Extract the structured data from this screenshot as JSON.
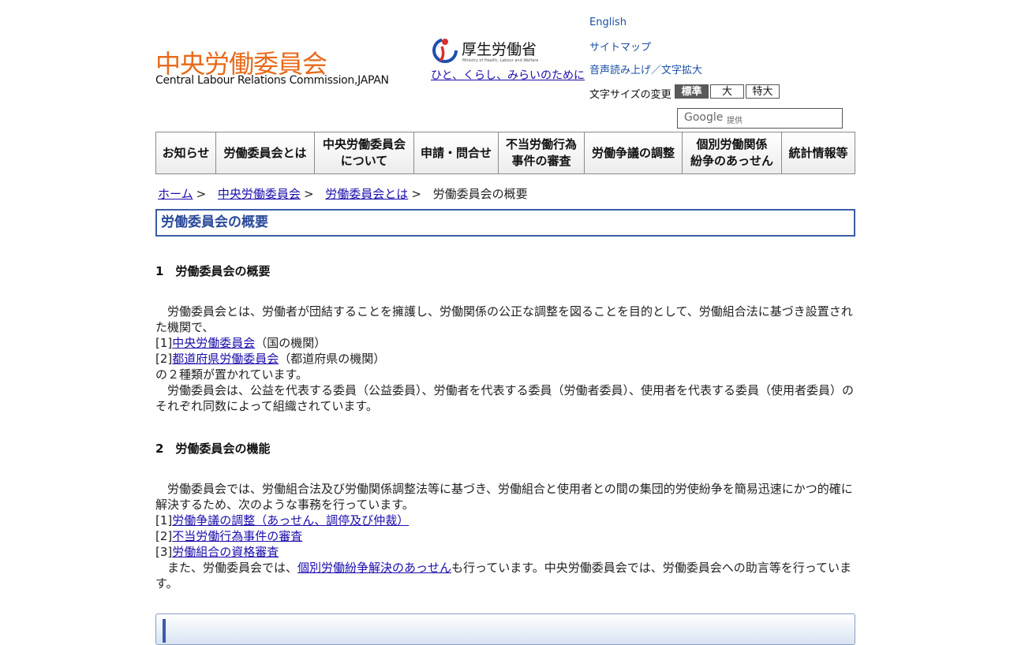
{
  "header": {
    "site_title": "中央労働委員会",
    "site_subtitle": "Central Labour Relations Commission,JAPAN",
    "mhlw_name": "厚生労働省",
    "mhlw_name_en": "Ministry of Health, Labour and Welfare",
    "mhlw_slogan": "ひと、くらし、みらいのために",
    "links": {
      "english": "English",
      "sitemap": "サイトマップ",
      "speech": "音声読み上げ／文字拡大"
    },
    "font_size_label": "文字サイズの変更",
    "font_size_buttons": [
      "標準",
      "大",
      "特大"
    ],
    "search_google": "Google",
    "search_provided": "提供"
  },
  "nav": [
    "お知らせ",
    "労働委員会とは",
    "中央労働委員会\nについて",
    "申請・問合せ",
    "不当労働行為\n事件の審査",
    "労働争議の調整",
    "個別労働関係\n紛争のあっせん",
    "統計情報等"
  ],
  "breadcrumb": {
    "home": "ホーム",
    "cat": "中央労働委員会",
    "sub": "労働委員会とは",
    "current": "労働委員会の概要",
    "sep": ">"
  },
  "page_title": "労働委員会の概要",
  "section1": {
    "heading": "1　労働委員会の概要",
    "para1": "　労働委員会とは、労働者が団結することを擁護し、労働関係の公正な調整を図ることを目的として、労働組合法に基づき設置された機関で、",
    "item1_num": "[1]",
    "item1_link": "中央労働委員会",
    "item1_rest": "（国の機関）",
    "item2_num": "[2]",
    "item2_link": "都道府県労働委員会",
    "item2_rest": "（都道府県の機関）",
    "line_after": "の２種類が置かれています。",
    "para2": "　労働委員会は、公益を代表する委員（公益委員）、労働者を代表する委員（労働者委員）、使用者を代表する委員（使用者委員）のそれぞれ同数によって組織されています。"
  },
  "section2": {
    "heading": "2　労働委員会の機能",
    "para1": "　労働委員会では、労働組合法及び労働関係調整法等に基づき、労働組合と使用者との間の集団的労使紛争を簡易迅速にかつ的確に解決するため、次のような事務を行っています。",
    "item1_num": "[1]",
    "item1_link": "労働争議の調整（あっせん、調停及び仲裁）",
    "item2_num": "[2]",
    "item2_link": "不当労働行為事件の審査",
    "item3_num": "[3]",
    "item3_link": "労働組合の資格審査",
    "para2_a": "　また、労働委員会では、",
    "para2_link": "個別労働紛争解決のあっせん",
    "para2_b": "も行っています。中央労働委員会では、労働委員会への助言等を行っています。"
  },
  "colors": {
    "title_orange": "#e86a1a",
    "link_blue": "#1a0dab",
    "heading_blue": "#2a4a9a"
  }
}
